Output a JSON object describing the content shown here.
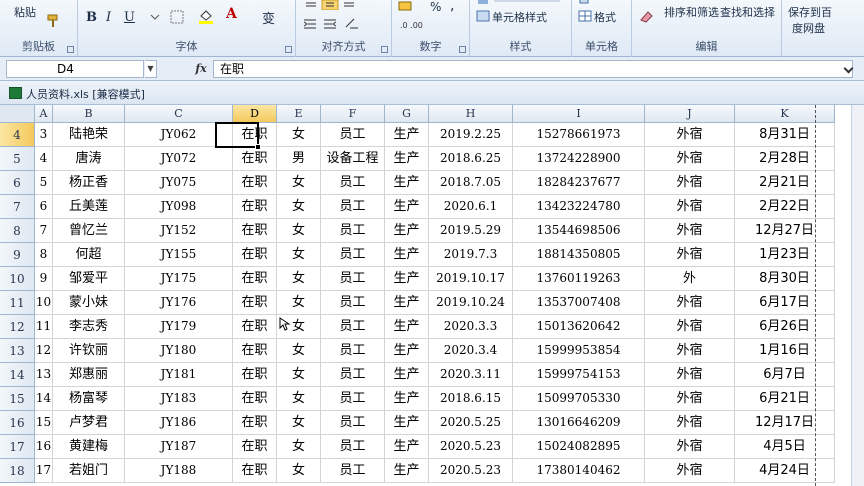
{
  "ribbon": {
    "groups": [
      {
        "label": "剪贴板",
        "buttons": [
          "粘贴"
        ]
      },
      {
        "label": "字体",
        "buttons": [
          "B",
          "I",
          "U",
          "A",
          "变"
        ]
      },
      {
        "label": "对齐方式"
      },
      {
        "label": "数字",
        "buttons": [
          "%",
          ","
        ]
      },
      {
        "label": "样式",
        "buttons": [
          "单元格样式"
        ]
      },
      {
        "label": "单元格",
        "buttons": [
          "格式"
        ]
      },
      {
        "label": "编辑",
        "buttons": [
          "排序和筛选",
          "查找和选择"
        ]
      },
      {
        "label": "",
        "buttons": [
          "保存到百",
          "度网盘"
        ]
      }
    ]
  },
  "formula_bar": {
    "name_box": "D4",
    "fx": "fx",
    "content": "在职"
  },
  "workbook": {
    "title": "人员资料.xls  [兼容模式]"
  },
  "sheet": {
    "columns": [
      "A",
      "B",
      "C",
      "D",
      "E",
      "F",
      "G",
      "H",
      "I",
      "J",
      "K"
    ],
    "selected_column": "D",
    "selected_row": "4",
    "rows": [
      {
        "row": "4",
        "cells": [
          "3",
          "陆艳荣",
          "JY062",
          "在职",
          "女",
          "员工",
          "生产",
          "2019.2.25",
          "15278661973",
          "外宿",
          "8月31日"
        ]
      },
      {
        "row": "5",
        "cells": [
          "4",
          "唐涛",
          "JY072",
          "在职",
          "男",
          "设备工程",
          "生产",
          "2018.6.25",
          "13724228900",
          "外宿",
          "2月28日"
        ]
      },
      {
        "row": "6",
        "cells": [
          "5",
          "杨正香",
          "JY075",
          "在职",
          "女",
          "员工",
          "生产",
          "2018.7.05",
          "18284237677",
          "外宿",
          "2月21日"
        ]
      },
      {
        "row": "7",
        "cells": [
          "6",
          "丘美莲",
          "JY098",
          "在职",
          "女",
          "员工",
          "生产",
          "2020.6.1",
          "13423224780",
          "外宿",
          "2月22日"
        ]
      },
      {
        "row": "8",
        "cells": [
          "7",
          "曾忆兰",
          "JY152",
          "在职",
          "女",
          "员工",
          "生产",
          "2019.5.29",
          "13544698506",
          "外宿",
          "12月27日"
        ]
      },
      {
        "row": "9",
        "cells": [
          "8",
          "何超",
          "JY155",
          "在职",
          "女",
          "员工",
          "生产",
          "2019.7.3",
          "18814350805",
          "外宿",
          "1月23日"
        ]
      },
      {
        "row": "10",
        "cells": [
          "9",
          "邹爱平",
          "JY175",
          "在职",
          "女",
          "员工",
          "生产",
          "2019.10.17",
          "13760119263",
          "外",
          "8月30日"
        ]
      },
      {
        "row": "11",
        "cells": [
          "10",
          "蒙小妹",
          "JY176",
          "在职",
          "女",
          "员工",
          "生产",
          "2019.10.24",
          "13537007408",
          "外宿",
          "6月17日"
        ]
      },
      {
        "row": "12",
        "cells": [
          "11",
          "李志秀",
          "JY179",
          "在职",
          "女",
          "员工",
          "生产",
          "2020.3.3",
          "15013620642",
          "外宿",
          "6月26日"
        ]
      },
      {
        "row": "13",
        "cells": [
          "12",
          "许钦丽",
          "JY180",
          "在职",
          "女",
          "员工",
          "生产",
          "2020.3.4",
          "15999953854",
          "外宿",
          "1月16日"
        ]
      },
      {
        "row": "14",
        "cells": [
          "13",
          "郑惠丽",
          "JY181",
          "在职",
          "女",
          "员工",
          "生产",
          "2020.3.11",
          "15999754153",
          "外宿",
          "6月7日"
        ]
      },
      {
        "row": "15",
        "cells": [
          "14",
          "杨富琴",
          "JY183",
          "在职",
          "女",
          "员工",
          "生产",
          "2018.6.15",
          "15099705330",
          "外宿",
          "6月21日"
        ]
      },
      {
        "row": "16",
        "cells": [
          "15",
          "卢梦君",
          "JY186",
          "在职",
          "女",
          "员工",
          "生产",
          "2020.5.25",
          "13016646209",
          "外宿",
          "12月17日"
        ]
      },
      {
        "row": "17",
        "cells": [
          "16",
          "黄建梅",
          "JY187",
          "在职",
          "女",
          "员工",
          "生产",
          "2020.5.23",
          "15024082895",
          "外宿",
          "4月5日"
        ]
      },
      {
        "row": "18",
        "cells": [
          "17",
          "若姐门",
          "JY188",
          "在职",
          "女",
          "员工",
          "生产",
          "2020.5.23",
          "17380140462",
          "外宿",
          "4月24日"
        ]
      }
    ]
  }
}
